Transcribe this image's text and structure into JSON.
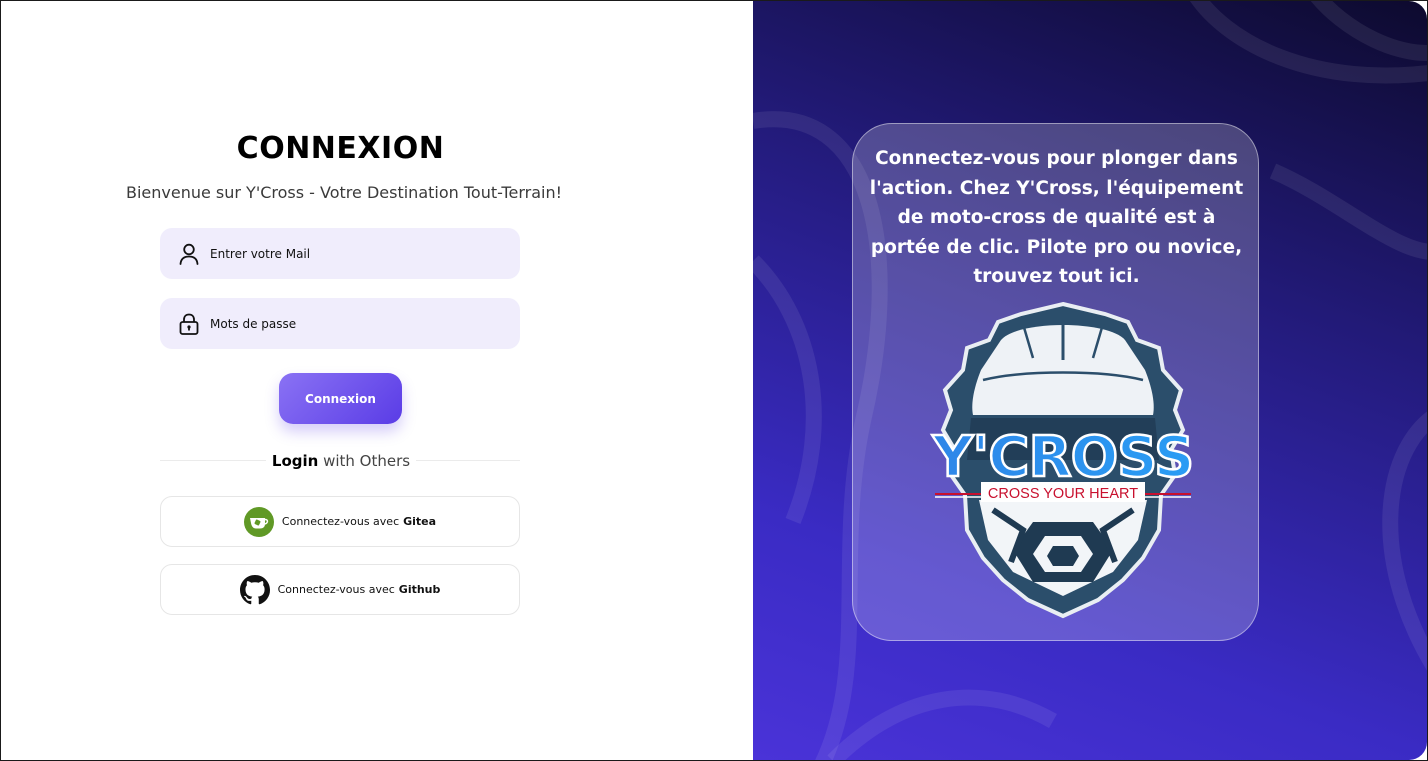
{
  "login": {
    "title": "CONNEXION",
    "subtitle": "Bienvenue sur Y'Cross - Votre Destination Tout-Terrain!",
    "email_placeholder": "Entrer votre Mail",
    "password_placeholder": "Mots de passe",
    "submit_label": "Connexion",
    "others_bold": "Login",
    "others_rest": "with Others",
    "gitea_prefix": "Connectez-vous avec",
    "gitea_name": "Gitea",
    "github_prefix": "Connectez-vous avec",
    "github_name": "Github"
  },
  "promo": {
    "text": "Connectez-vous pour plonger dans l'action. Chez Y'Cross, l'équipement de moto-cross de qualité est à portée de clic. Pilote pro ou novice, trouvez tout ici.",
    "logo_title": "Y'CROSS",
    "logo_tagline": "CROSS YOUR HEART"
  },
  "colors": {
    "accent": "#6b4ff0",
    "field_bg": "#f0edfc",
    "gitea_green": "#609926",
    "panel_dark": "#0d0a2e",
    "panel_light": "#4a33d8"
  },
  "icons": {
    "email": "user-icon",
    "password": "lock-icon",
    "gitea": "gitea-icon",
    "github": "github-icon"
  }
}
